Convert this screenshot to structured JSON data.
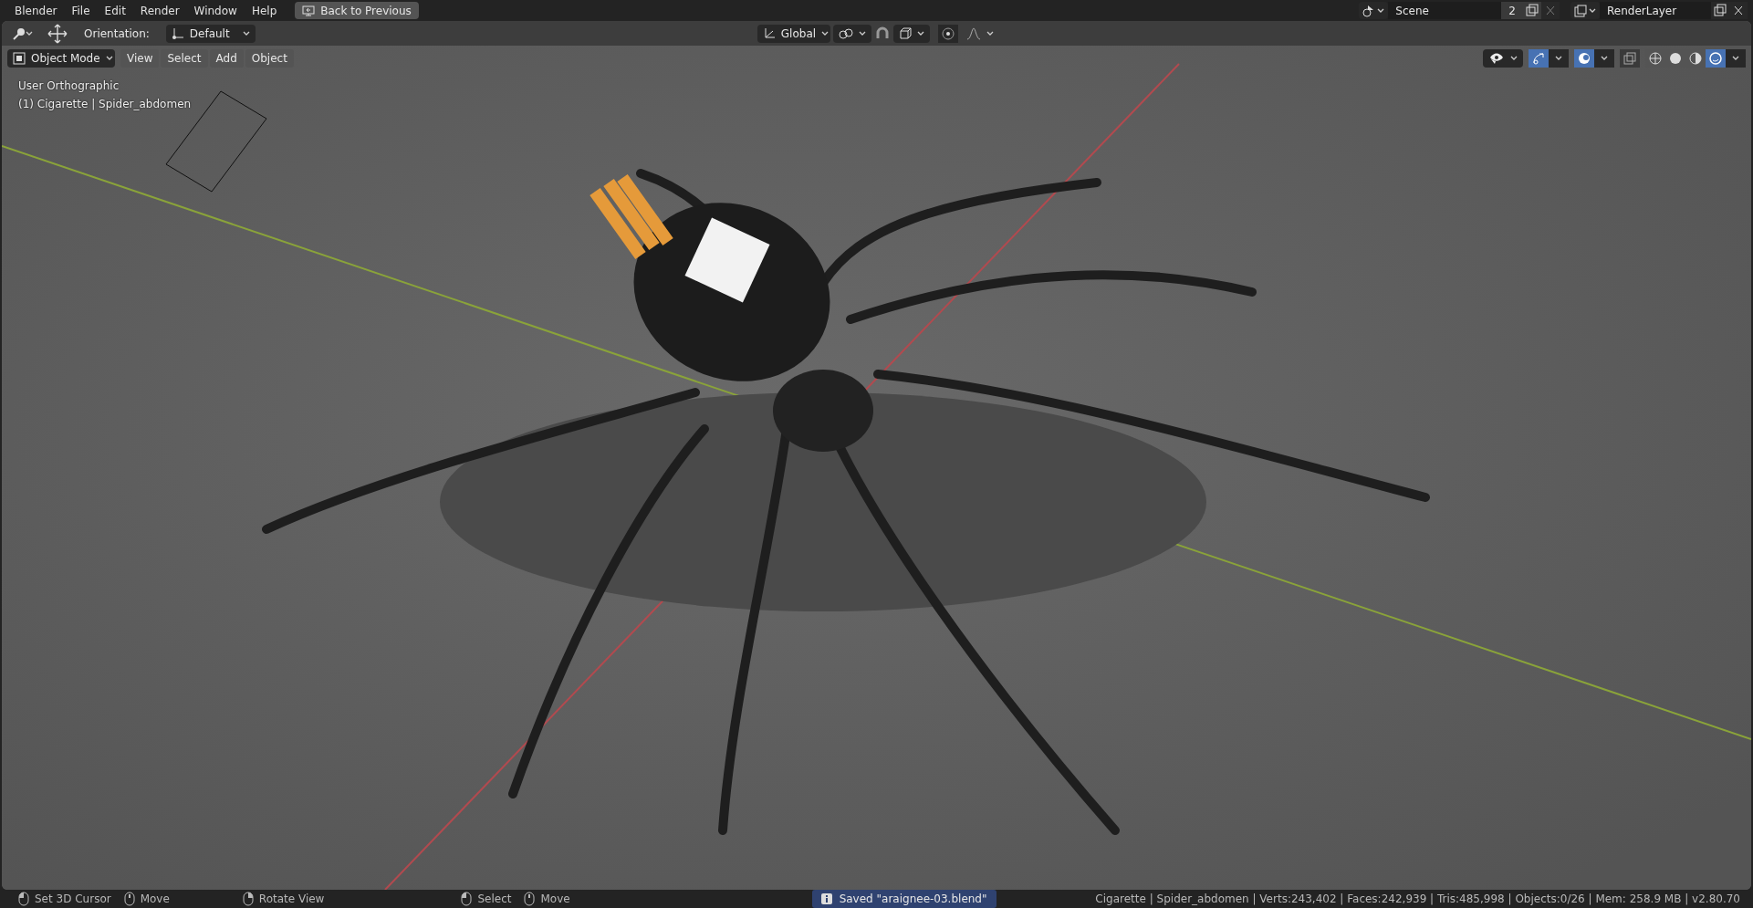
{
  "top_bar": {
    "app_menu": "Blender",
    "menus": [
      "File",
      "Edit",
      "Render",
      "Window",
      "Help"
    ],
    "back_button": "Back to Previous"
  },
  "scene": {
    "name": "Scene",
    "users": "2"
  },
  "view_layer": {
    "name": "RenderLayer"
  },
  "tool_header": {
    "orientation_label": "Orientation:",
    "orientation_value": "Default",
    "transform_orientation": "Global",
    "proportional_on": false
  },
  "viewport_header": {
    "mode": "Object Mode",
    "menus": [
      "View",
      "Select",
      "Add",
      "Object"
    ],
    "gizmos_on": true,
    "overlays_on": true,
    "xray_on": false,
    "shading": [
      {
        "kind": "wireframe",
        "selected": false
      },
      {
        "kind": "solid",
        "selected": false
      },
      {
        "kind": "material",
        "selected": false
      },
      {
        "kind": "rendered",
        "selected": true
      }
    ]
  },
  "viewport": {
    "view_name": "User Orthographic",
    "object_info": "(1) Cigarette | Spider_abdomen"
  },
  "status_bar": {
    "hints": [
      {
        "kind": "left",
        "label": "Set 3D Cursor"
      },
      {
        "kind": "middle",
        "label": "Move"
      },
      {
        "kind": "right",
        "label": "Rotate View"
      },
      {
        "kind": "left",
        "label": "Select"
      },
      {
        "kind": "middle",
        "label": "Move"
      }
    ],
    "report": "Saved \"araignee-03.blend\"",
    "stats": "Cigarette | Spider_abdomen | Verts:243,402 | Faces:242,939 | Tris:485,998 | Objects:0/26 | Mem: 258.9 MB | v2.80.70"
  }
}
